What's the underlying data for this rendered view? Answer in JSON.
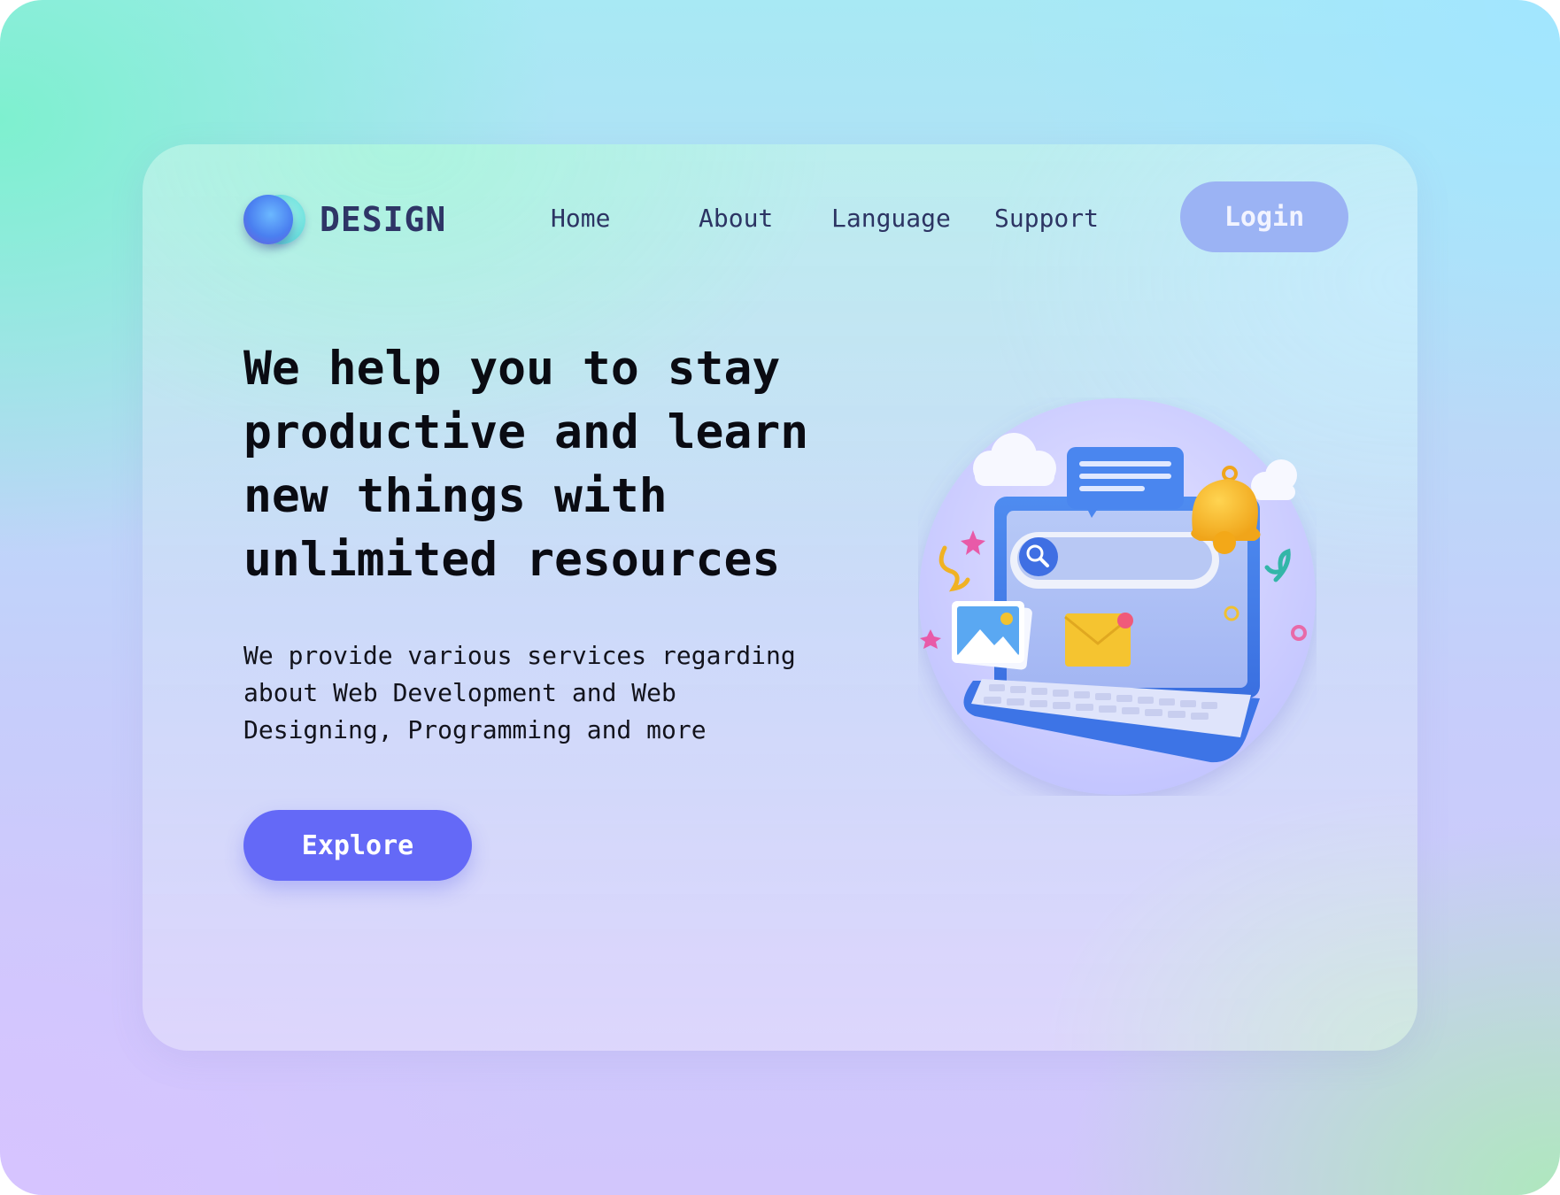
{
  "logo": {
    "text": "DESIGN",
    "icon": "overlapping-circles-logo"
  },
  "nav": {
    "items": [
      {
        "label": "Home"
      },
      {
        "label": "About"
      },
      {
        "label": "Language"
      },
      {
        "label": "Support"
      }
    ],
    "login_label": "Login"
  },
  "hero": {
    "title": "We help you to stay\nproductive and learn\nnew things with\nunlimited resources",
    "description": "We provide various services regarding\nabout Web Development and Web\nDesigning, Programming and more",
    "cta_label": "Explore",
    "illustration": "laptop-3d-illustration"
  },
  "colors": {
    "brand_text": "#2e3566",
    "login_button": "#9bb3f4",
    "explore_button": "#6469f7",
    "title_text": "#0a0b12"
  }
}
